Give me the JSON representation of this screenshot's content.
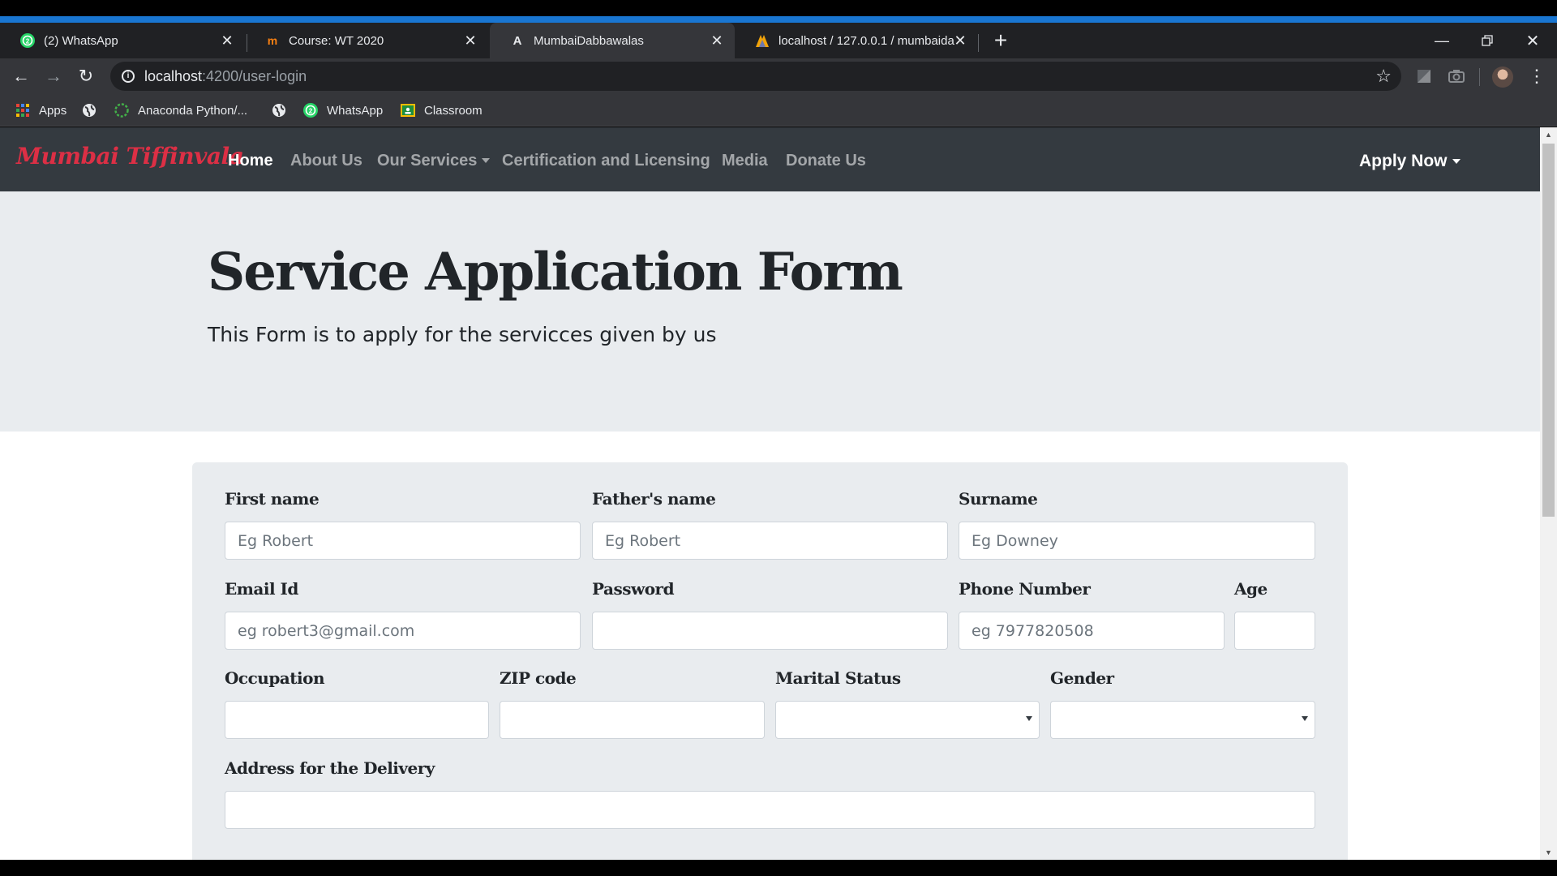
{
  "browser": {
    "tabs": [
      {
        "title": "(2) WhatsApp",
        "icon": "whatsapp-icon"
      },
      {
        "title": "Course: WT 2020",
        "icon": "moodle-icon"
      },
      {
        "title": "MumbaiDabbawalas",
        "icon": "angular-icon"
      },
      {
        "title": "localhost / 127.0.0.1 / mumbaida",
        "icon": "phpmyadmin-icon"
      }
    ],
    "address_bar": {
      "host": "localhost",
      "path": ":4200/user-login"
    },
    "bookmarks": [
      {
        "label": "Apps",
        "icon": "apps-grid-icon"
      },
      {
        "label": "",
        "icon": "globe-icon"
      },
      {
        "label": "Anaconda Python/...",
        "icon": "anaconda-icon"
      },
      {
        "label": "",
        "icon": "globe-icon"
      },
      {
        "label": "WhatsApp",
        "icon": "whatsapp-icon"
      },
      {
        "label": "Classroom",
        "icon": "classroom-icon"
      }
    ],
    "accent_color": "#1976d2"
  },
  "site": {
    "brand": "Mumbai Tiffinvala",
    "brand_color": "#dc2f45",
    "nav": {
      "home": "Home",
      "about": "About Us",
      "services": "Our Services",
      "certification": "Certification and Licensing",
      "media": "Media",
      "donate": "Donate Us",
      "apply": "Apply Now"
    },
    "jumbotron": {
      "title": "Service Application Form",
      "subtitle": "This Form is to apply for the servicces given by us"
    },
    "form": {
      "first_name": {
        "label": "First name",
        "placeholder": "Eg Robert",
        "value": ""
      },
      "fathers_name": {
        "label": "Father's name",
        "placeholder": "Eg Robert",
        "value": ""
      },
      "surname": {
        "label": "Surname",
        "placeholder": "Eg Downey",
        "value": ""
      },
      "email": {
        "label": "Email Id",
        "placeholder": "eg robert3@gmail.com",
        "value": ""
      },
      "password": {
        "label": "Password",
        "placeholder": "",
        "value": ""
      },
      "phone": {
        "label": "Phone Number",
        "placeholder": "eg 7977820508",
        "value": ""
      },
      "age": {
        "label": "Age",
        "placeholder": "",
        "value": ""
      },
      "occupation": {
        "label": "Occupation",
        "placeholder": "",
        "value": ""
      },
      "zip": {
        "label": "ZIP code",
        "placeholder": "",
        "value": ""
      },
      "marital_status": {
        "label": "Marital Status",
        "selected": ""
      },
      "gender": {
        "label": "Gender",
        "selected": ""
      },
      "address": {
        "label": "Address for the Delivery",
        "placeholder": "",
        "value": ""
      }
    }
  }
}
